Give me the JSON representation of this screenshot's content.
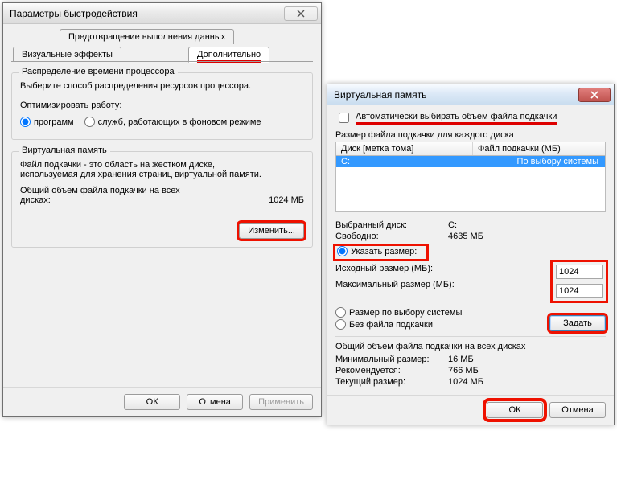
{
  "perf": {
    "title": "Параметры быстродействия",
    "tabs": {
      "dep": "Предотвращение выполнения данных",
      "visual": "Визуальные эффекты",
      "advanced": "Дополнительно"
    },
    "sched": {
      "legend": "Распределение времени процессора",
      "desc": "Выберите способ распределения ресурсов процессора.",
      "optLabel": "Оптимизировать работу:",
      "programs": "программ",
      "services": "служб, работающих в фоновом режиме"
    },
    "vm": {
      "legend": "Виртуальная память",
      "desc1": "Файл подкачки - это область на жестком диске,",
      "desc2": "используемая для хранения страниц виртуальной памяти.",
      "totalLbl1": "Общий объем файла подкачки на всех",
      "totalLbl2": "дисках:",
      "totalVal": "1024 МБ",
      "changeBtn": "Изменить..."
    },
    "buttons": {
      "ok": "ОК",
      "cancel": "Отмена",
      "apply": "Применить"
    }
  },
  "vmdlg": {
    "title": "Виртуальная память",
    "autoChk": "Автоматически выбирать объем файла подкачки",
    "perDriveLbl": "Размер файла подкачки для каждого диска",
    "col1": "Диск [метка тома]",
    "col2": "Файл подкачки (МБ)",
    "row": {
      "drive": "C:",
      "val": "По выбору системы"
    },
    "selDriveLbl": "Выбранный диск:",
    "selDriveVal": "C:",
    "freeLbl": "Свободно:",
    "freeVal": "4635 МБ",
    "customRadio": "Указать размер:",
    "initLbl": "Исходный размер (МБ):",
    "initVal": "1024",
    "maxLbl": "Максимальный размер (МБ):",
    "maxVal": "1024",
    "sysRadio": "Размер по выбору системы",
    "noneRadio": "Без файла подкачки",
    "setBtn": "Задать",
    "totalLbl": "Общий объем файла подкачки на всех дисках",
    "minLbl": "Минимальный размер:",
    "minVal": "16 МБ",
    "recLbl": "Рекомендуется:",
    "recVal": "766 МБ",
    "curLbl": "Текущий размер:",
    "curVal": "1024 МБ",
    "ok": "ОК",
    "cancel": "Отмена"
  }
}
